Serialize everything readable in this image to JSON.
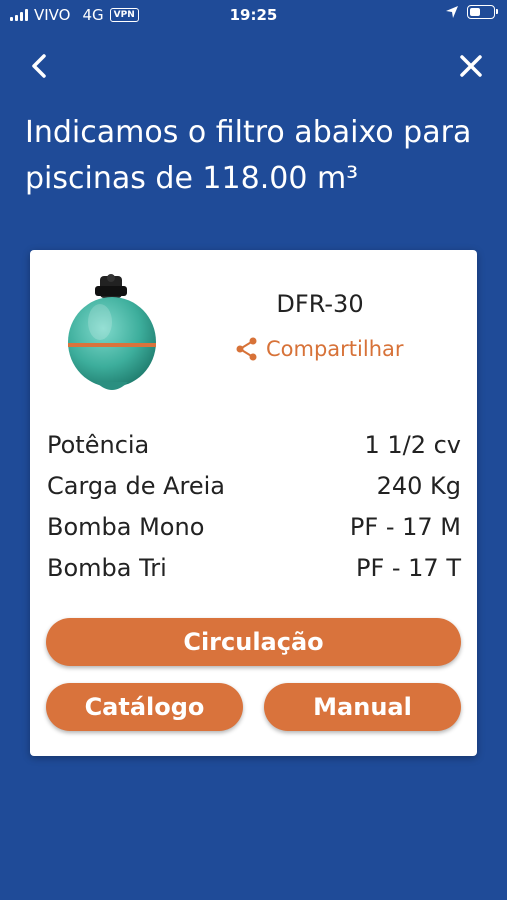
{
  "status_bar": {
    "carrier": "VIVO",
    "network": "4G",
    "vpn": "VPN",
    "time": "19:25"
  },
  "header": {
    "title": "Indicamos o filtro abaixo para piscinas de 118.00 m³"
  },
  "product": {
    "model": "DFR-30",
    "share_label": "Compartilhar",
    "specs": [
      {
        "label": "Potência",
        "value": "1 1/2 cv"
      },
      {
        "label": "Carga de Areia",
        "value": "240 Kg"
      },
      {
        "label": "Bomba Mono",
        "value": "PF - 17 M"
      },
      {
        "label": "Bomba Tri",
        "value": "PF - 17 T"
      }
    ]
  },
  "buttons": {
    "circulation": "Circulação",
    "catalog": "Catálogo",
    "manual": "Manual"
  },
  "colors": {
    "background": "#1f4b98",
    "accent": "#d9733c",
    "card": "#ffffff"
  }
}
